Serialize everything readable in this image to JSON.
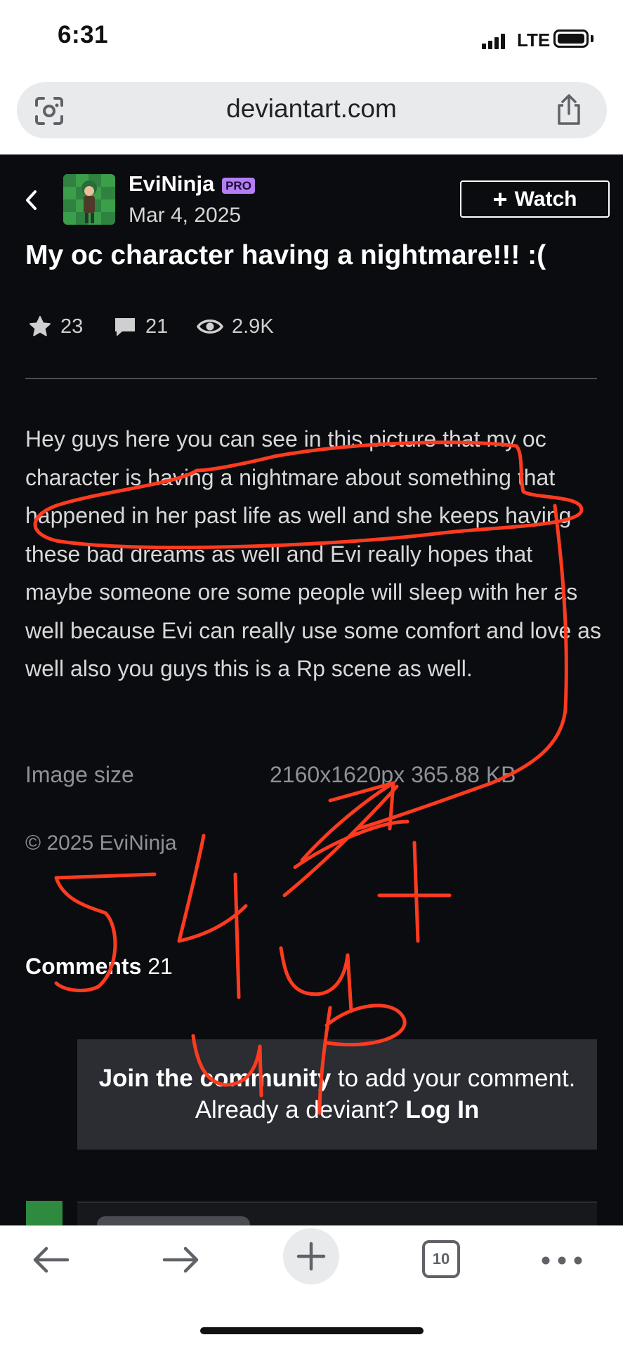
{
  "status_bar": {
    "time": "6:31",
    "network": "LTE"
  },
  "browser": {
    "url": "deviantart.com"
  },
  "deviation": {
    "author": "EviNinja",
    "author_badge": "PRO",
    "date": "Mar 4, 2025",
    "watch_label": "Watch",
    "title": "My oc character having a nightmare!!! :(",
    "stats": {
      "favourites": "23",
      "comments": "21",
      "views": "2.9K"
    },
    "description": "Hey guys here you can see in this picture that my oc character is having a nightmare about something that happened in her past life as well and she keeps having these bad dreams as well and Evi really hopes that maybe someone ore some people will sleep with her as well because Evi can really use some comfort and love as well also you guys this is a Rp scene as well.",
    "image_size_label": "Image size",
    "image_size_value": "2160x1620px 365.88 KB",
    "copyright": "© 2025 EviNinja"
  },
  "comments": {
    "label": "Comments",
    "count": "21",
    "join_bold": "Join the community",
    "join_rest": " to add your comment. Already a deviant? ",
    "login": "Log In"
  },
  "toolbar": {
    "tab_count": "10"
  },
  "colors": {
    "page_bg": "#0b0c10",
    "pro_badge": "#b57ef6",
    "scribble": "#ff3b1f",
    "join_box": "#2b2d33"
  }
}
